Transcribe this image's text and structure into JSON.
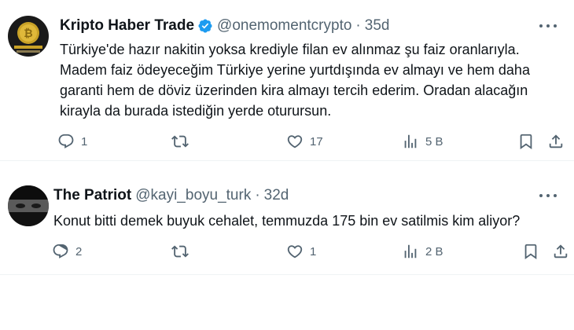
{
  "tweets": [
    {
      "display_name": "Kripto Haber Trade",
      "verified": true,
      "handle": "@onemomentcrypto",
      "separator": "·",
      "time": "35d",
      "text": "Türkiye'de hazır nakitin yoksa krediyle filan ev alınmaz şu faiz oranlarıyla. Madem faiz ödeyeceğim Türkiye yerine yurtdışında ev almayı ve hem daha garanti hem de döviz üzerinden kira almayı tercih ederim. Oradan alacağın kirayla da burada istediğin yerde oturursun.",
      "replies": "1",
      "retweets": "",
      "likes": "17",
      "views": "5 B"
    },
    {
      "display_name": "The Patriot",
      "verified": false,
      "handle": "@kayi_boyu_turk",
      "separator": "·",
      "time": "32d",
      "text": "Konut bitti demek buyuk cehalet, temmuzda 175 bin ev satilmis kim aliyor?",
      "replies": "2",
      "retweets": "",
      "likes": "1",
      "views": "2 B"
    }
  ],
  "colors": {
    "text": "#0f1419",
    "secondary": "#536471",
    "verified": "#1d9bf0",
    "divider": "#eff3f4"
  },
  "icons": [
    "reply-icon",
    "retweet-icon",
    "like-icon",
    "views-icon",
    "bookmark-icon",
    "share-icon",
    "verified-badge-icon",
    "more-options-icon"
  ]
}
